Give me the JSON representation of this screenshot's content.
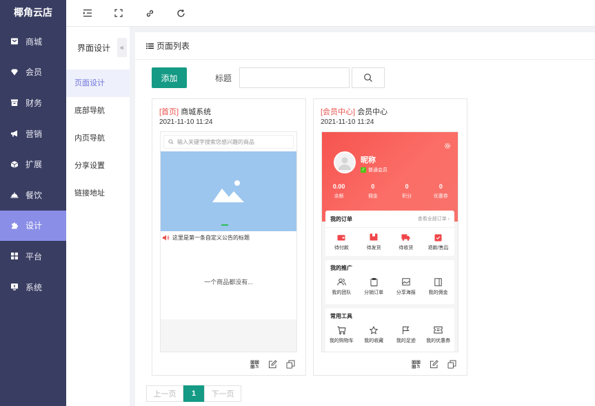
{
  "brand": "椰角云店",
  "nav": [
    {
      "label": "商城",
      "icon": "mail-icon"
    },
    {
      "label": "会员",
      "icon": "diamond-icon"
    },
    {
      "label": "财务",
      "icon": "archive-icon"
    },
    {
      "label": "营销",
      "icon": "megaphone-icon"
    },
    {
      "label": "扩展",
      "icon": "cube-icon"
    },
    {
      "label": "餐饮",
      "icon": "cloche-icon"
    },
    {
      "label": "设计",
      "icon": "puzzle-icon"
    },
    {
      "label": "平台",
      "icon": "grid-icon"
    },
    {
      "label": "系统",
      "icon": "monitor-icon"
    }
  ],
  "subnav": {
    "title": "界面设计",
    "items": [
      "页面设计",
      "底部导航",
      "内页导航",
      "分享设置",
      "链接地址"
    ]
  },
  "main": {
    "header": "页面列表",
    "add_label": "添加",
    "title_label": "标题",
    "search_value": ""
  },
  "cards": [
    {
      "tag": "[首页]",
      "name": "商城系统",
      "date": "2021-11-10 11:24",
      "search_placeholder": "输入关键字搜索您感兴趣的商品",
      "notice": "这里是第一条自定义公告的标题",
      "empty": "一个商品都没有..."
    },
    {
      "tag": "[会员中心]",
      "name": "会员中心",
      "date": "2021-11-10 11:24",
      "nickname": "昵称",
      "level": "普通会员",
      "stats": [
        {
          "value": "0.00",
          "label": "余额"
        },
        {
          "value": "0",
          "label": "佣金"
        },
        {
          "value": "0",
          "label": "积分"
        },
        {
          "value": "0",
          "label": "优惠券"
        }
      ],
      "orders": {
        "title": "我的订单",
        "more": "查看全部订单 ›",
        "items": [
          "待付款",
          "待发货",
          "待收货",
          "退款/售后"
        ]
      },
      "promo": {
        "title": "我的推广",
        "items": [
          "我的团队",
          "分销订单",
          "分享海报",
          "我的佣金"
        ]
      },
      "tools": {
        "title": "常用工具",
        "items": [
          "我的购物车",
          "我的收藏",
          "我的足迹",
          "我的优惠券"
        ]
      }
    }
  ],
  "pagination": {
    "prev": "上一页",
    "current": "1",
    "next": "下一页"
  },
  "colors": {
    "sidebar": "#393d61",
    "active": "#8a8ee6",
    "primary": "#149a85",
    "accent": "#f6534f"
  }
}
